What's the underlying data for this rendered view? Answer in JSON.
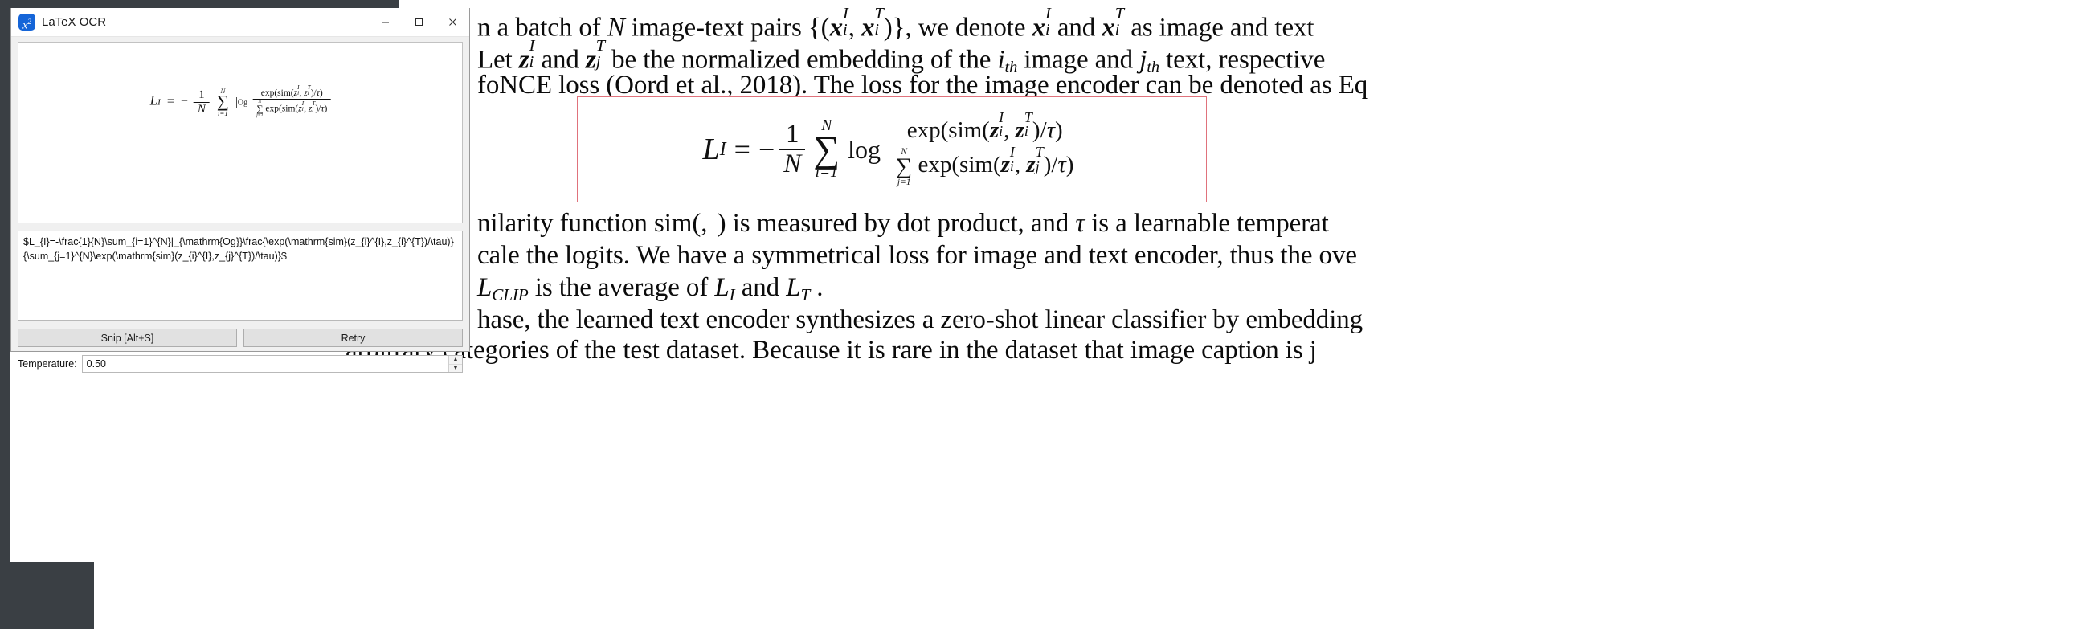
{
  "desktop": {
    "background_color": "#3a3f44"
  },
  "document": {
    "lines": [
      {
        "id": "l1",
        "text": "n a batch of N image-text pairs {(x^I_i , x^T_i )}, we denote x^I_i and x^T_i as image and text"
      },
      {
        "id": "l2",
        "text": "Let z^I_i and z^T_j be the normalized embedding of the i_th image and j_th text, respective"
      },
      {
        "id": "l3",
        "text": "foNCE loss (Oord et al., 2018). The loss for the image encoder can be denoted as Eq"
      },
      {
        "id": "l4",
        "text": "nilarity function sim(, ) is measured by dot product, and τ is a learnable temperat"
      },
      {
        "id": "l5",
        "text": "cale the logits. We have a symmetrical loss for image and text encoder, thus the ove"
      },
      {
        "id": "l6",
        "text": "L_CLIP is the average of L_I and L_T ."
      },
      {
        "id": "l7",
        "text": "hase, the learned text encoder synthesizes a zero-shot linear classifier by embedding"
      },
      {
        "id": "l8",
        "text": "arbitrary categories of the test dataset. Because it is rare in the dataset that image caption is j"
      }
    ],
    "equation_box": {
      "border_color": "#e0727c",
      "latex": "L_I = -\\frac{1}{N}\\sum_{i=1}^{N}\\log\\frac{\\exp(\\mathrm{sim}(z_i^I,z_i^T)/\\tau)}{\\sum_{j=1}^{N}\\exp(\\mathrm{sim}(z_i^I,z_j^T)/\\tau)}",
      "lhs": "L",
      "lhs_sub": "I",
      "equals": "=",
      "minus": "−",
      "frac_num": "1",
      "frac_den": "N",
      "sum_upper": "N",
      "sum_symbol": "∑",
      "sum_lower": "i=1",
      "log": "log",
      "big_num": "exp(sim(z",
      "big_den_sum": "∑",
      "tau": "τ"
    }
  },
  "window": {
    "title": "LaTeX OCR",
    "icon": "x-squared-icon",
    "icon_text": "x",
    "icon_sup": "2",
    "controls": {
      "minimize": "−",
      "maximize": "□",
      "close": "✕"
    },
    "preview": {
      "label": "rendered-latex-preview"
    },
    "code": {
      "value": "$L_{I}=-\\frac{1}{N}\\sum_{i=1}^{N}|_{\\mathrm{Og}}\\frac{\\exp(\\mathrm{sim}(z_{i}^{I},z_{i}^{T})/\\tau)}{\\sum_{j=1}^{N}\\exp(\\mathrm{sim}(z_{i}^{I},z_{j}^{T})/\\tau)}$"
    },
    "buttons": {
      "snip": "Snip [Alt+S]",
      "retry": "Retry"
    },
    "temperature": {
      "label": "Temperature:",
      "value": "0.50",
      "up_arrow": "▲",
      "down_arrow": "▼"
    }
  }
}
